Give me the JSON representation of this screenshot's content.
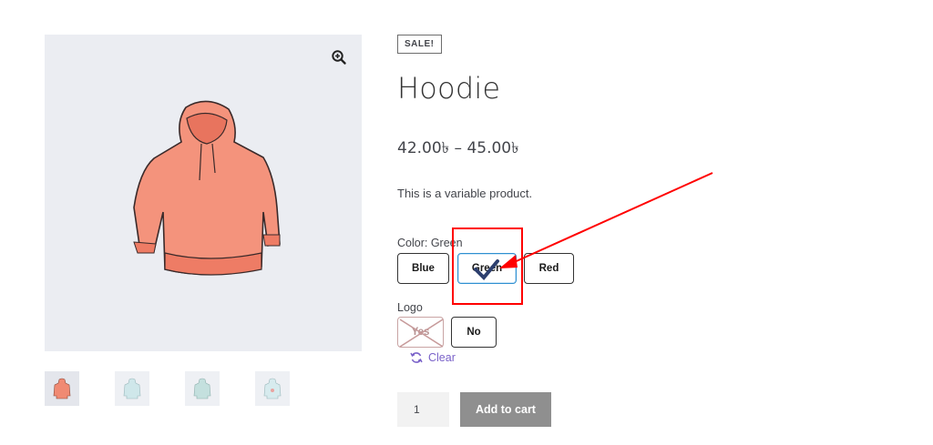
{
  "product": {
    "badge": "SALE!",
    "title": "Hoodie",
    "price": "42.00৳ – 45.00৳",
    "description": "This is a variable product."
  },
  "gallery": {
    "zoom_icon": "zoom-in-icon",
    "thumbnail_count": 4
  },
  "attributes": {
    "color": {
      "label": "Color: Green",
      "options": [
        "Blue",
        "Green",
        "Red"
      ],
      "selected": "Green"
    },
    "logo": {
      "label": "Logo",
      "options": [
        "Yes",
        "No"
      ],
      "disabled": "Yes"
    },
    "clear_label": "Clear"
  },
  "cart": {
    "quantity": "1",
    "add_label": "Add to cart"
  },
  "colors": {
    "hoodie": "#f08a73",
    "selected_border": "#2e8fd0",
    "annotation": "#ff0000",
    "clear_link": "#7a62c9",
    "add_button": "#8f8f8f"
  }
}
